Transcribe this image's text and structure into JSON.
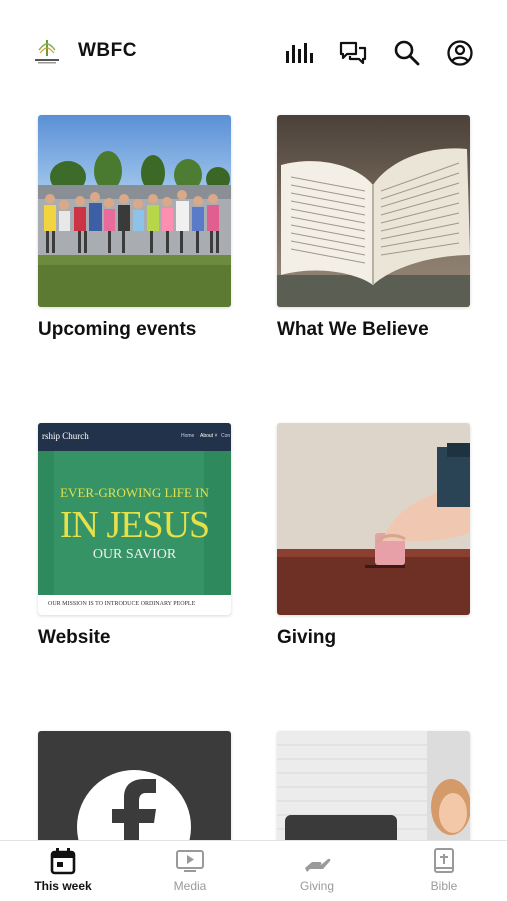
{
  "header": {
    "title": "WBFC",
    "logo_icon": "church-logo",
    "actions": [
      "bar-chart-icon",
      "chat-icon",
      "search-icon",
      "profile-icon"
    ]
  },
  "cards": [
    {
      "label": "Upcoming events"
    },
    {
      "label": "What We Believe"
    },
    {
      "label": "Website",
      "preview": {
        "nav_brand": "rship Church",
        "nav_links": [
          "Home",
          "About ˅",
          "Con"
        ],
        "line1": "EVER-GROWING LIFE IN",
        "line2": "IN JESUS",
        "line3": "OUR SAVIOR",
        "mission": "OUR MISSION IS TO INTRODUCE ORDINARY PEOPLE"
      }
    },
    {
      "label": "Giving"
    },
    {
      "label": ""
    },
    {
      "label": ""
    }
  ],
  "tabbar": {
    "tabs": [
      {
        "label": "This week",
        "icon": "calendar-icon",
        "active": true
      },
      {
        "label": "Media",
        "icon": "video-icon",
        "active": false
      },
      {
        "label": "Giving",
        "icon": "giving-hand-icon",
        "active": false
      },
      {
        "label": "Bible",
        "icon": "bible-icon",
        "active": false
      }
    ]
  },
  "colors": {
    "active": "#111111",
    "inactive": "#9a9a9a",
    "website_green": "#2e8a5c",
    "website_yellow": "#e6e04a"
  }
}
